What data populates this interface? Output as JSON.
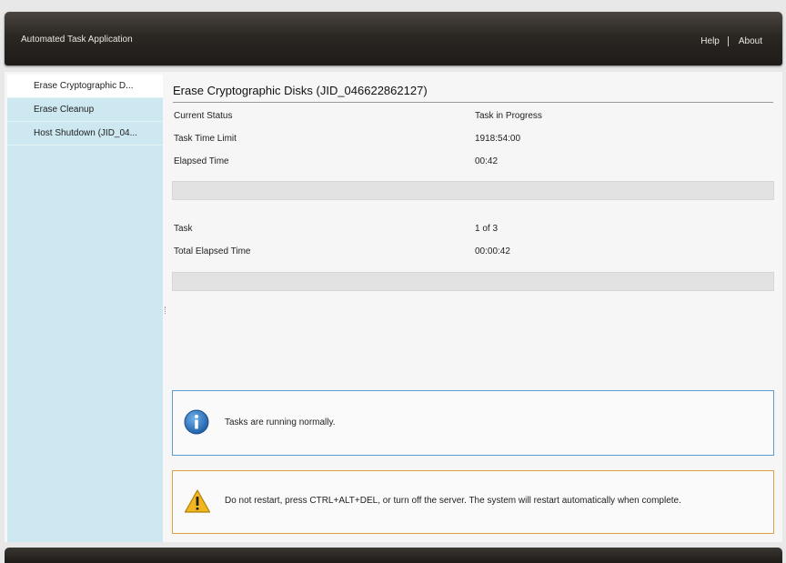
{
  "header": {
    "app_title": "Automated Task Application",
    "help_label": "Help",
    "about_label": "About"
  },
  "sidebar": {
    "items": [
      {
        "label": "Erase Cryptographic D...",
        "active": true
      },
      {
        "label": "Erase Cleanup",
        "active": false
      },
      {
        "label": "Host Shutdown (JID_04...",
        "active": false
      }
    ]
  },
  "main": {
    "title": "Erase Cryptographic Disks (JID_046622862127)",
    "current_status_label": "Current Status",
    "current_status_value": "Task in Progress",
    "time_limit_label": "Task Time Limit",
    "time_limit_value": "1918:54:00",
    "elapsed_label": "Elapsed Time",
    "elapsed_value": "00:42",
    "task_progress": 0,
    "task_label": "Task",
    "task_value": "1 of 3",
    "total_elapsed_label": "Total Elapsed Time",
    "total_elapsed_value": "00:00:42",
    "overall_progress": 0
  },
  "messages": {
    "info_icon": "info-icon",
    "info_text": "Tasks are running normally.",
    "warn_icon": "warning-icon",
    "warn_text": "Do not restart, press CTRL+ALT+DEL, or turn off the server.  The system will restart automatically when complete."
  },
  "colors": {
    "sidebar_bg": "#cde8f0",
    "info_border": "#5a9bd0",
    "warn_border": "#e0a040",
    "info_icon": "#1f6fbf",
    "warn_icon": "#f2b61e"
  }
}
